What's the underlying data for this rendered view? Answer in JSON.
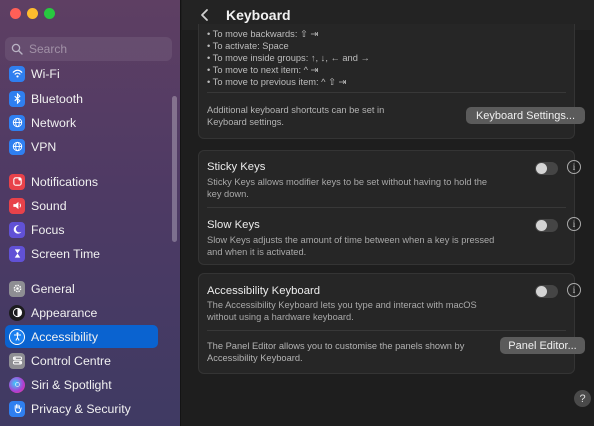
{
  "window": {
    "title": "Keyboard"
  },
  "search": {
    "placeholder": "Search"
  },
  "sidebar": {
    "items": [
      {
        "label": "Wi-Fi",
        "icon": "wifi-icon",
        "color": "#2f7ff0"
      },
      {
        "label": "Bluetooth",
        "icon": "bluetooth-icon",
        "color": "#2f7ff0"
      },
      {
        "label": "Network",
        "icon": "globe-icon",
        "color": "#2f7ff0"
      },
      {
        "label": "VPN",
        "icon": "vpn-globe-icon",
        "color": "#2f7ff0"
      },
      {
        "label": "Notifications",
        "icon": "bell-icon",
        "color": "#e8424a"
      },
      {
        "label": "Sound",
        "icon": "speaker-icon",
        "color": "#e8424a"
      },
      {
        "label": "Focus",
        "icon": "moon-icon",
        "color": "#6151d6"
      },
      {
        "label": "Screen Time",
        "icon": "hourglass-icon",
        "color": "#6151d6"
      },
      {
        "label": "General",
        "icon": "gear-icon",
        "color": "#8e8e93"
      },
      {
        "label": "Appearance",
        "icon": "appearance-icon",
        "color": "#1c1c1e"
      },
      {
        "label": "Accessibility",
        "icon": "accessibility-icon",
        "color": "#1a7ff0",
        "active": true
      },
      {
        "label": "Control Centre",
        "icon": "control-centre-icon",
        "color": "#8e8e93"
      },
      {
        "label": "Siri & Spotlight",
        "icon": "siri-icon",
        "color": "#b13bd1"
      },
      {
        "label": "Privacy & Security",
        "icon": "hand-icon",
        "color": "#2f7ff0"
      }
    ]
  },
  "keyboard_nav": {
    "lines": [
      "• To move backwards: ⇧ ⇥",
      "• To activate: Space",
      "• To move inside groups: ↑, ↓, ← and →",
      "• To move to next item: ^ ⇥",
      "• To move to previous item: ^ ⇧ ⇥"
    ],
    "shortcuts_desc_1": "Additional keyboard shortcuts can be set in",
    "shortcuts_desc_2": "Keyboard settings.",
    "settings_button": "Keyboard Settings..."
  },
  "sticky_keys": {
    "title": "Sticky Keys",
    "desc_1": "Sticky Keys allows modifier keys to be set without having to hold the",
    "desc_2": "key down.",
    "enabled": false
  },
  "slow_keys": {
    "title": "Slow Keys",
    "desc_1": "Slow Keys adjusts the amount of time between when a key is pressed",
    "desc_2": "and when it is activated.",
    "enabled": false
  },
  "accessibility_keyboard": {
    "title": "Accessibility Keyboard",
    "desc_1": "The Accessibility Keyboard lets you type and interact with macOS",
    "desc_2": "without using a hardware keyboard.",
    "enabled": false,
    "panel_desc_1": "The Panel Editor allows you to customise the panels shown by",
    "panel_desc_2": "Accessibility Keyboard.",
    "panel_button": "Panel Editor..."
  },
  "info_glyph": "i",
  "help_glyph": "?",
  "colors": {
    "accent": "#0a63d0",
    "close": "#ff5f57",
    "minimize": "#febc2e",
    "zoom": "#28c840"
  }
}
